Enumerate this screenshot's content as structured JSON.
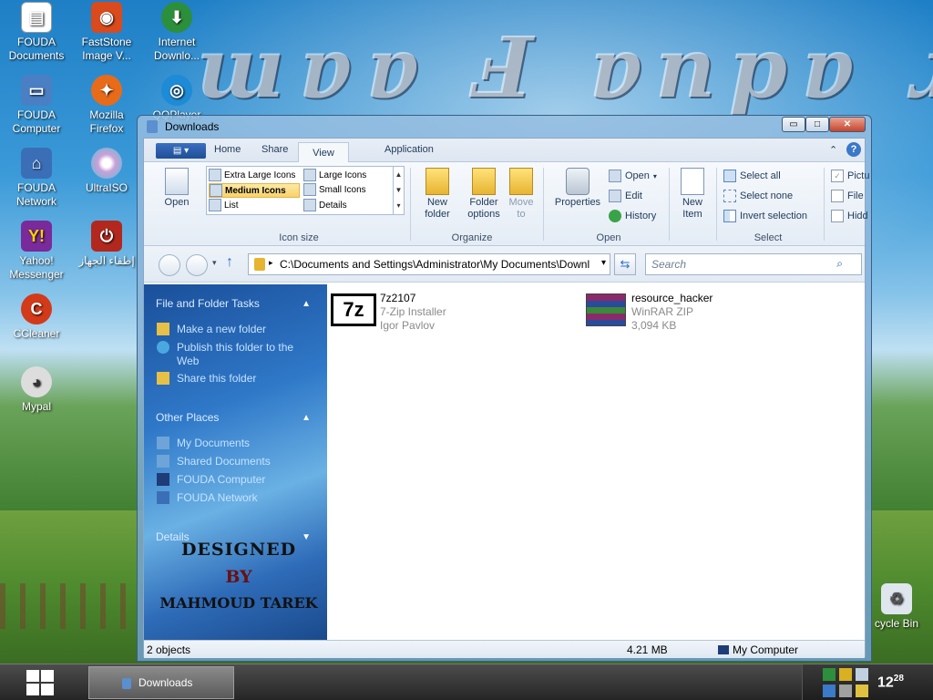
{
  "desktop": {
    "wallpaper_text": "ɯɐɐ Ⅎ ɐnpɐ ɹ",
    "icons": [
      {
        "label": "FOUDA Documents",
        "icon": "documents-icon"
      },
      {
        "label": "FastStone Image V...",
        "icon": "faststone-icon"
      },
      {
        "label": "Internet Downlo...",
        "icon": "internet-download-icon"
      },
      {
        "label": "FOUDA Computer",
        "icon": "computer-icon"
      },
      {
        "label": "Mozilla Firefox",
        "icon": "firefox-icon"
      },
      {
        "label": "QQPlayer",
        "icon": "qqplayer-icon"
      },
      {
        "label": "FOUDA Network",
        "icon": "network-icon"
      },
      {
        "label": "UltraISO",
        "icon": "ultraiso-icon"
      },
      {
        "label": "Yahoo! Messenger",
        "icon": "yahoo-messenger-icon"
      },
      {
        "label": "إطفاء الجهاز",
        "icon": "shutdown-icon"
      },
      {
        "label": "CCleaner",
        "icon": "ccleaner-icon"
      },
      {
        "label": "Mypal",
        "icon": "mypal-icon"
      },
      {
        "label": "cycle Bin",
        "icon": "recycle-bin-icon"
      }
    ]
  },
  "window": {
    "title": "Downloads",
    "controls": {
      "minimize": "▭",
      "maximize": "□",
      "close": "✕"
    }
  },
  "ribbon": {
    "tabs": [
      {
        "label": "Home"
      },
      {
        "label": "Share"
      },
      {
        "label": "View"
      },
      {
        "label": "Application"
      }
    ],
    "layout_group": {
      "label": "Icon size",
      "open": "Open",
      "options": [
        "Extra Large Icons",
        "Large Icons",
        "Medium Icons",
        "Small Icons",
        "List",
        "Details"
      ],
      "selected": "Medium Icons"
    },
    "organize_group": {
      "label": "Organize",
      "new_folder": "New folder",
      "folder_options": "Folder options",
      "move_to": "Move to"
    },
    "open_group": {
      "label": "Open",
      "properties": "Properties",
      "open": "Open",
      "edit": "Edit",
      "history": "History"
    },
    "new_group": {
      "new_item": "New Item"
    },
    "select_group": {
      "label": "Select",
      "select_all": "Select all",
      "select_none": "Select none",
      "invert": "Invert selection"
    },
    "show_group": {
      "picture": "Pictu",
      "file": "File",
      "hidden": "Hidd"
    }
  },
  "address": {
    "path": "C:\\Documents and Settings\\Administrator\\My Documents\\Downl",
    "search_placeholder": "Search"
  },
  "left_pane": {
    "file_tasks": {
      "heading": "File and Folder Tasks",
      "items": [
        "Make a new folder",
        "Publish this folder to the Web",
        "Share this folder"
      ]
    },
    "other_places": {
      "heading": "Other Places",
      "items": [
        "My Documents",
        "Shared Documents",
        "FOUDA Computer",
        "FOUDA Network"
      ]
    },
    "details": {
      "heading": "Details"
    },
    "branding": {
      "line1": "DESIGNED",
      "line2": "BY",
      "line3": "MAHMOUD TAREK"
    }
  },
  "files": [
    {
      "name": "7z2107",
      "type": "7-Zip Installer",
      "meta": "Igor Pavlov",
      "icon": "7zip-icon"
    },
    {
      "name": "resource_hacker",
      "type": "WinRAR ZIP",
      "meta": "3,094 KB",
      "icon": "winrar-icon"
    }
  ],
  "status": {
    "count": "2 objects",
    "size": "4.21 MB",
    "location": "My Computer"
  },
  "taskbar": {
    "task": "Downloads",
    "clock_hour": "12",
    "clock_min": "28"
  }
}
